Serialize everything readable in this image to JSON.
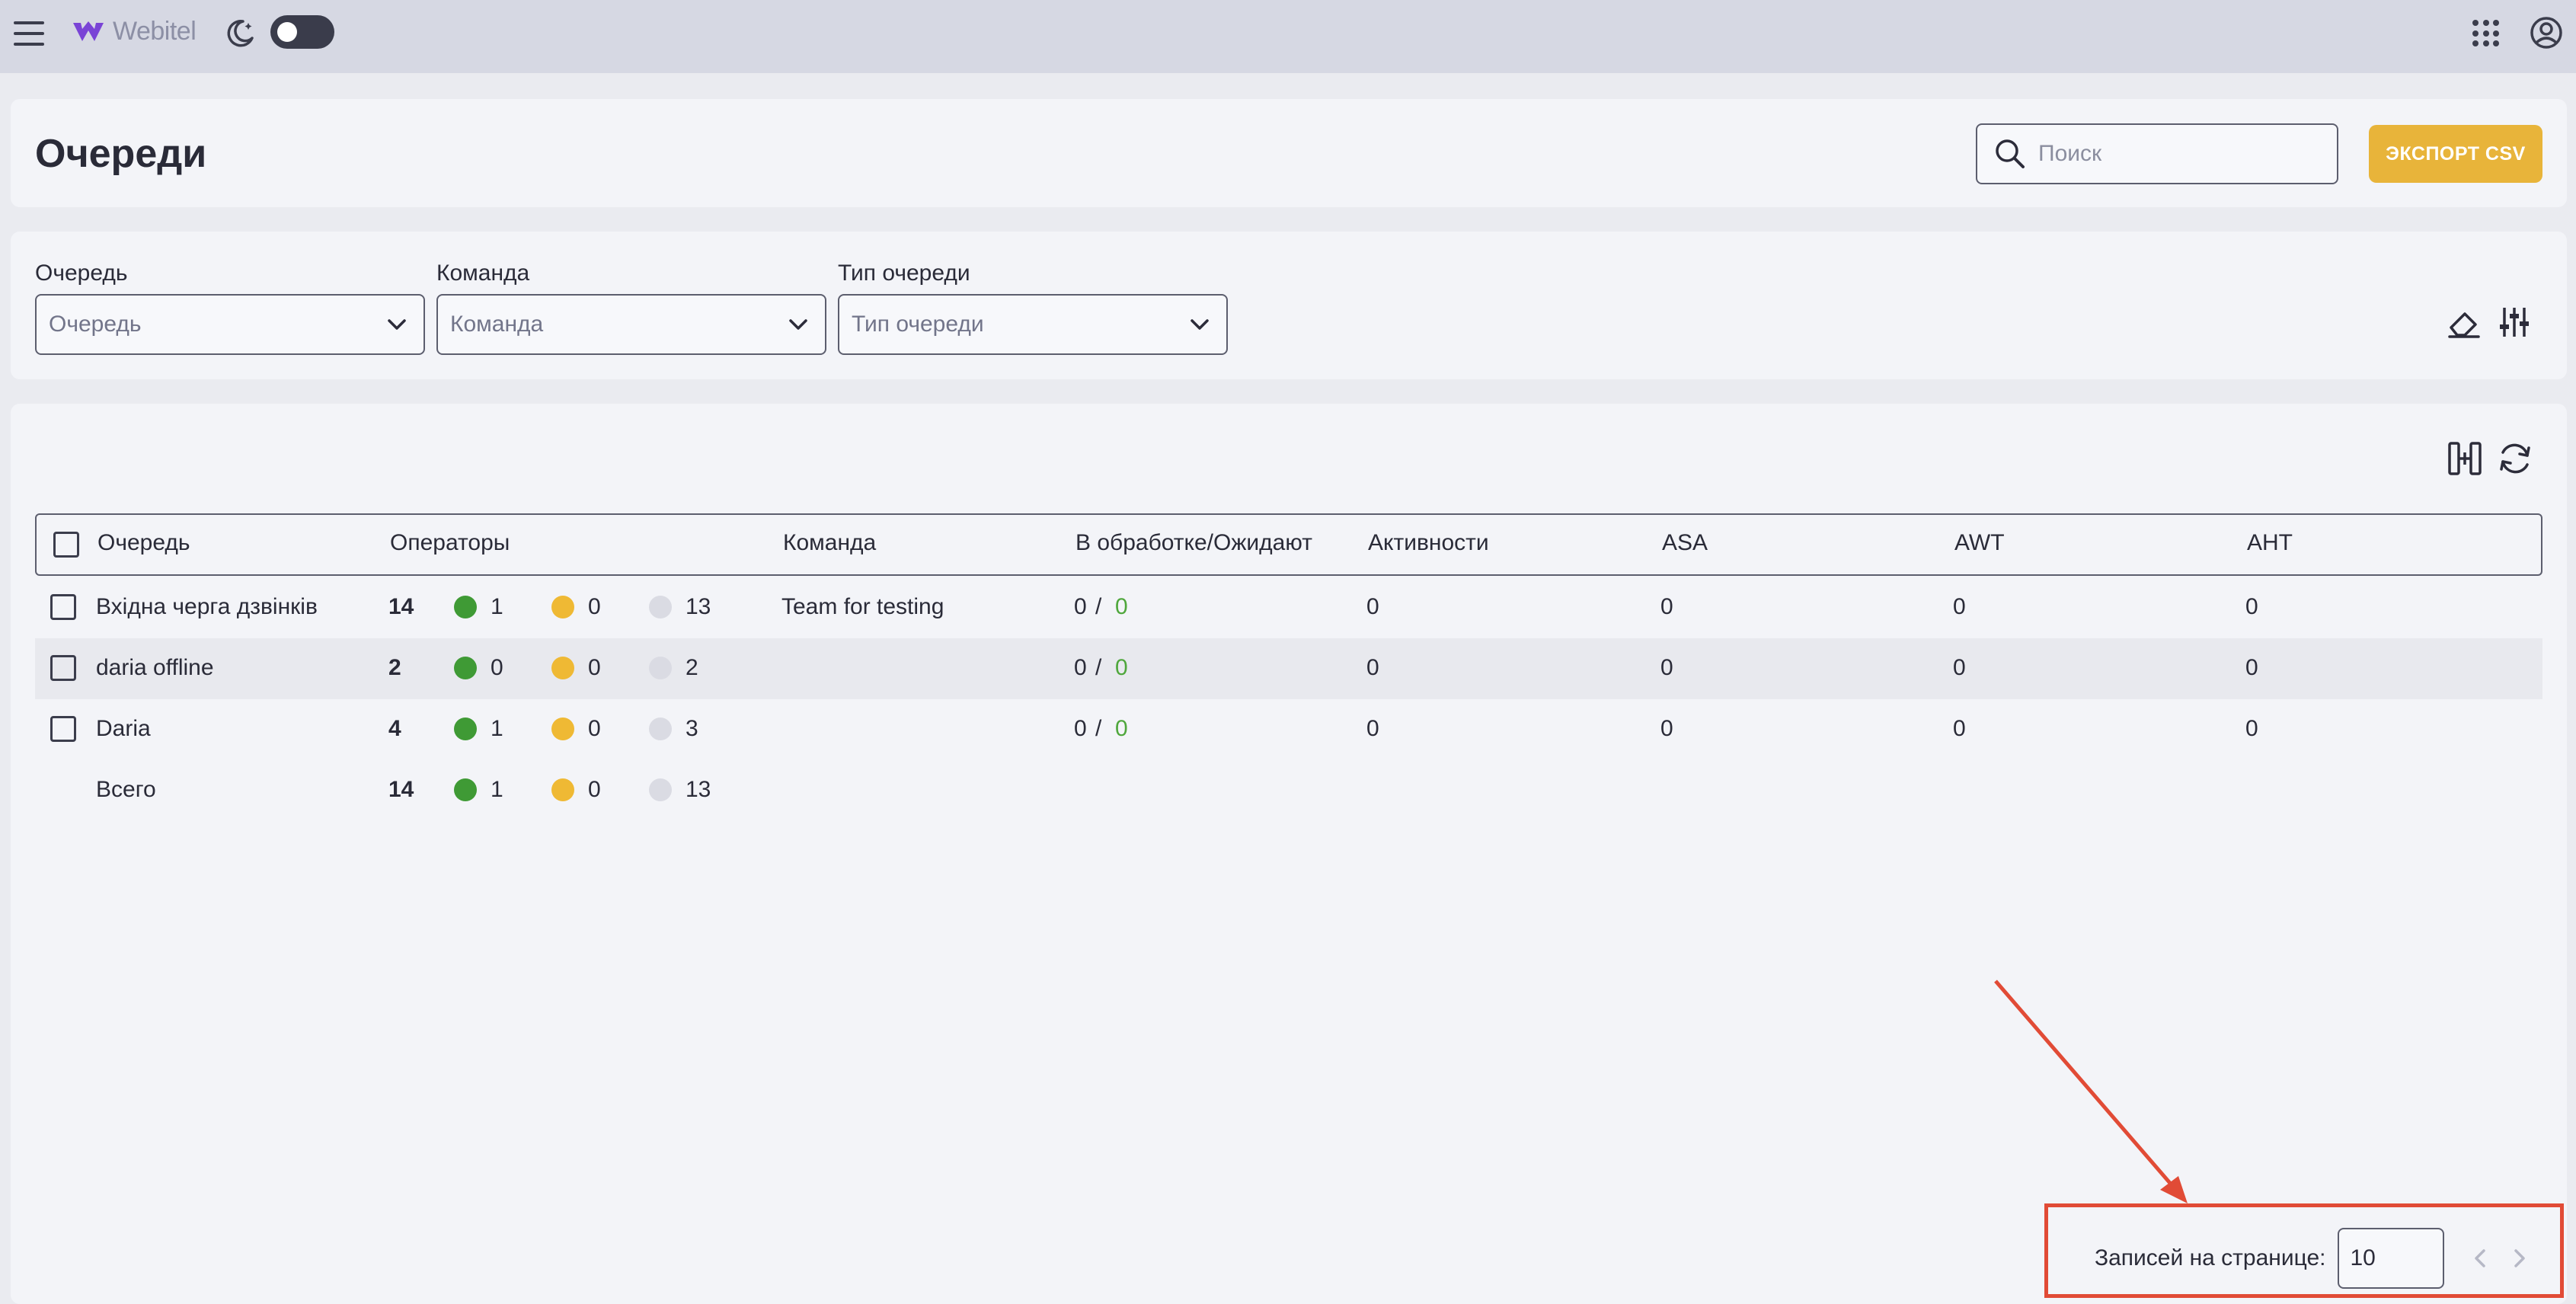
{
  "app": {
    "brand": "Webitel"
  },
  "header": {
    "title": "Очереди",
    "search_placeholder": "Поиск",
    "export_label": "ЭКСПОРТ CSV"
  },
  "filters": [
    {
      "label": "Очередь",
      "placeholder": "Очередь"
    },
    {
      "label": "Команда",
      "placeholder": "Команда"
    },
    {
      "label": "Тип очереди",
      "placeholder": "Тип очереди"
    }
  ],
  "table": {
    "columns": [
      "Очередь",
      "Операторы",
      "Команда",
      "В обработке/Ожидают",
      "Активности",
      "ASA",
      "AWT",
      "AHT"
    ],
    "rows": [
      {
        "name": "Вхідна черга дзвінків",
        "total": "14",
        "online": "1",
        "pause": "0",
        "offline": "13",
        "team": "Team for testing",
        "processing": "0",
        "sep": "/",
        "waiting": "0",
        "activity": "0",
        "asa": "0",
        "awt": "0",
        "aht": "0"
      },
      {
        "name": "daria offline",
        "total": "2",
        "online": "0",
        "pause": "0",
        "offline": "2",
        "team": "",
        "processing": "0",
        "sep": "/",
        "waiting": "0",
        "activity": "0",
        "asa": "0",
        "awt": "0",
        "aht": "0"
      },
      {
        "name": "Daria",
        "total": "4",
        "online": "1",
        "pause": "0",
        "offline": "3",
        "team": "",
        "processing": "0",
        "sep": "/",
        "waiting": "0",
        "activity": "0",
        "asa": "0",
        "awt": "0",
        "aht": "0"
      }
    ],
    "summary": {
      "label": "Всего",
      "total": "14",
      "online": "1",
      "pause": "0",
      "offline": "13"
    }
  },
  "pagination": {
    "label": "Записей на странице:",
    "per_page": "10"
  },
  "colors": {
    "accent": "#e8b43a",
    "online": "#3f9a35",
    "pause": "#efb934",
    "offline": "#dadbe3",
    "annotation": "#e14b36"
  },
  "icons": [
    "menu-icon",
    "webitel-logo",
    "moon-icon",
    "apps-icon",
    "user-icon",
    "search-icon",
    "chevron-down-icon",
    "eraser-icon",
    "sliders-icon",
    "column-select-icon",
    "refresh-icon",
    "chevron-left-icon",
    "chevron-right-icon"
  ]
}
